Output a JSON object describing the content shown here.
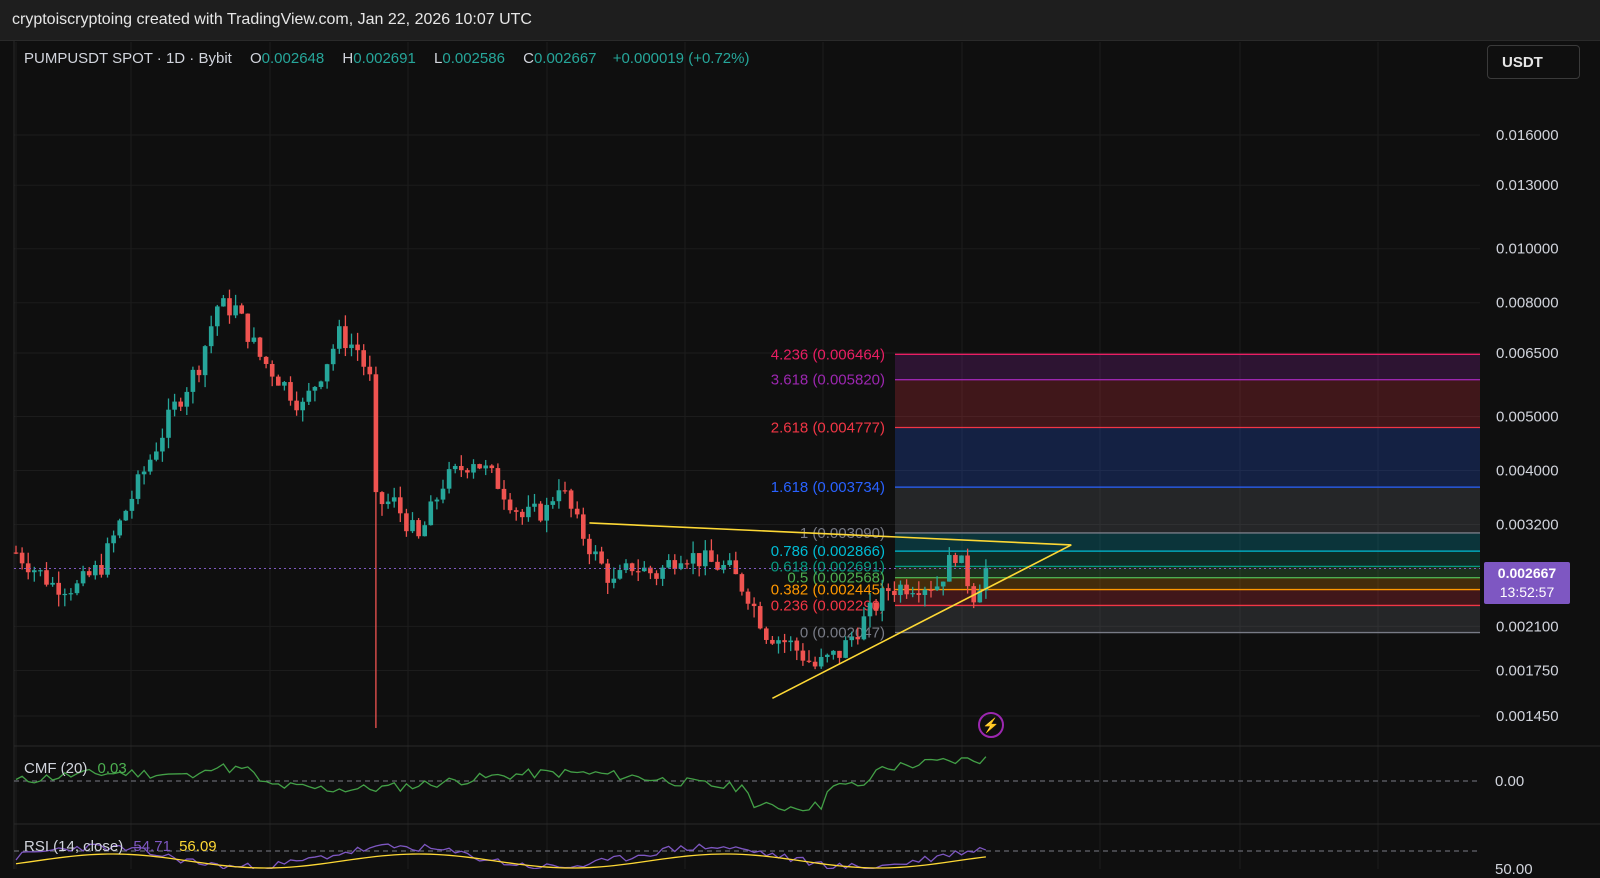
{
  "header": {
    "title": "cryptoiscryptoing created with TradingView.com, Jan 22, 2026 10:07 UTC"
  },
  "symbol": {
    "name": "PUMPUSDT SPOT · 1D · Bybit",
    "o_label": "O",
    "o": "0.002648",
    "h_label": "H",
    "h": "0.002691",
    "l_label": "L",
    "l": "0.002586",
    "c_label": "C",
    "c": "0.002667",
    "change": "+0.000019 (+0.72%)"
  },
  "currency_button": "USDT",
  "price_tag": {
    "price": "0.002667",
    "countdown": "13:52:57"
  },
  "indicators": {
    "cmf": {
      "label": "CMF (20)",
      "value": "0.03",
      "zero_label": "0.00"
    },
    "rsi": {
      "label": "RSI (14, close)",
      "value1": "54.71",
      "value2": "56.09",
      "level_label": "50.00"
    }
  },
  "colors": {
    "up": "#26a69a",
    "down": "#ef5350",
    "background": "#0f0f0f",
    "grid": "#1d1d1d",
    "accent": "#7e57c2"
  },
  "chart_data": {
    "type": "candlestick",
    "y_scale": "log",
    "y_ticks": [
      {
        "label": "0.016000",
        "value": 0.016
      },
      {
        "label": "0.013000",
        "value": 0.013
      },
      {
        "label": "0.010000",
        "value": 0.01
      },
      {
        "label": "0.008000",
        "value": 0.008
      },
      {
        "label": "0.006500",
        "value": 0.0065
      },
      {
        "label": "0.005000",
        "value": 0.005
      },
      {
        "label": "0.004000",
        "value": 0.004
      },
      {
        "label": "0.003200",
        "value": 0.0032
      },
      {
        "label": "0.002100",
        "value": 0.0021
      },
      {
        "label": "0.001750",
        "value": 0.00175
      },
      {
        "label": "0.001450",
        "value": 0.00145
      }
    ],
    "ylim": [
      0.0013,
      0.021
    ],
    "fib_levels": [
      {
        "label": "4.236 (0.006464)",
        "ratio": 4.236,
        "price": 0.006464,
        "color": "#e91e63"
      },
      {
        "label": "3.618 (0.005820)",
        "ratio": 3.618,
        "price": 0.00582,
        "color": "#9c27b0"
      },
      {
        "label": "2.618 (0.004777)",
        "ratio": 2.618,
        "price": 0.004777,
        "color": "#f23645"
      },
      {
        "label": "1.618 (0.003734)",
        "ratio": 1.618,
        "price": 0.003734,
        "color": "#2962ff"
      },
      {
        "label": "1 (0.003090)",
        "ratio": 1,
        "price": 0.00309,
        "color": "#787b86"
      },
      {
        "label": "0.786 (0.002866)",
        "ratio": 0.786,
        "price": 0.002866,
        "color": "#00bcd4"
      },
      {
        "label": "0.618 (0.002691)",
        "ratio": 0.618,
        "price": 0.002691,
        "color": "#089981"
      },
      {
        "label": "0.5 (0.002568)",
        "ratio": 0.5,
        "price": 0.002568,
        "color": "#4caf50"
      },
      {
        "label": "0.382 (0.002445)",
        "ratio": 0.382,
        "price": 0.002445,
        "color": "#ff9800"
      },
      {
        "label": "0.236 (0.002290)",
        "ratio": 0.236,
        "price": 0.00229,
        "color": "#f23645"
      },
      {
        "label": "0 (0.002047)",
        "ratio": 0,
        "price": 0.002047,
        "color": "#787b86"
      }
    ],
    "close_path": [
      [
        0,
        0.00285
      ],
      [
        6,
        0.0025
      ],
      [
        10,
        0.00247
      ],
      [
        14,
        0.0027
      ],
      [
        18,
        0.0034
      ],
      [
        22,
        0.0042
      ],
      [
        26,
        0.0052
      ],
      [
        30,
        0.0062
      ],
      [
        33,
        0.0079
      ],
      [
        36,
        0.0078
      ],
      [
        40,
        0.0064
      ],
      [
        44,
        0.0057
      ],
      [
        47,
        0.0052
      ],
      [
        50,
        0.006
      ],
      [
        53,
        0.007
      ],
      [
        56,
        0.0066
      ],
      [
        58,
        0.0058
      ],
      [
        59,
        0.0035
      ],
      [
        62,
        0.0035
      ],
      [
        66,
        0.003
      ],
      [
        70,
        0.0038
      ],
      [
        75,
        0.0042
      ],
      [
        79,
        0.0038
      ],
      [
        83,
        0.0033
      ],
      [
        87,
        0.0034
      ],
      [
        89,
        0.0038
      ],
      [
        92,
        0.0032
      ],
      [
        95,
        0.0028
      ],
      [
        98,
        0.0025
      ],
      [
        101,
        0.0027
      ],
      [
        105,
        0.0026
      ],
      [
        109,
        0.00285
      ],
      [
        113,
        0.00275
      ],
      [
        117,
        0.00265
      ],
      [
        120,
        0.0024
      ],
      [
        123,
        0.00205
      ],
      [
        127,
        0.00195
      ],
      [
        131,
        0.00178
      ],
      [
        135,
        0.00188
      ],
      [
        139,
        0.00215
      ],
      [
        143,
        0.00245
      ],
      [
        147,
        0.0025
      ],
      [
        151,
        0.0025
      ],
      [
        154,
        0.00285
      ],
      [
        157,
        0.0024
      ],
      [
        159,
        0.00266
      ]
    ],
    "bar_count": 160,
    "wick_spike": {
      "bar": 59,
      "low": 0.00138
    }
  }
}
